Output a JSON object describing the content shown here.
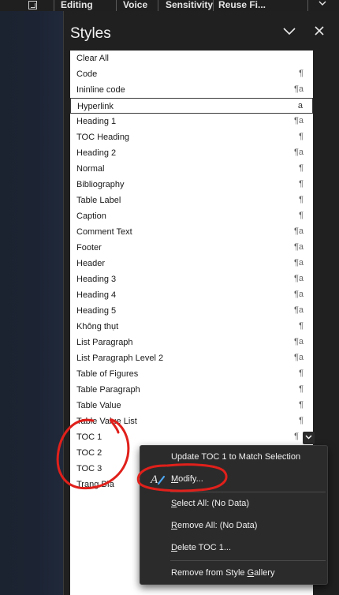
{
  "ribbon": {
    "tabs": [
      "Editing",
      "Voice",
      "Sensitivity",
      "Reuse Fi..."
    ]
  },
  "pane": {
    "title": "Styles"
  },
  "styles": [
    {
      "name": "Clear All",
      "glyph": ""
    },
    {
      "name": "Code",
      "glyph": "¶"
    },
    {
      "name": "Ininline code",
      "glyph": "¶a"
    },
    {
      "name": "Hyperlink",
      "glyph": "a",
      "selected": true
    },
    {
      "name": "Heading 1",
      "glyph": "¶a"
    },
    {
      "name": "TOC Heading",
      "glyph": "¶"
    },
    {
      "name": "Heading 2",
      "glyph": "¶a"
    },
    {
      "name": "Normal",
      "glyph": "¶"
    },
    {
      "name": "Bibliography",
      "glyph": "¶"
    },
    {
      "name": "Table Label",
      "glyph": "¶"
    },
    {
      "name": "Caption",
      "glyph": "¶"
    },
    {
      "name": "Comment Text",
      "glyph": "¶a"
    },
    {
      "name": "Footer",
      "glyph": "¶a"
    },
    {
      "name": "Header",
      "glyph": "¶a"
    },
    {
      "name": "Heading 3",
      "glyph": "¶a"
    },
    {
      "name": "Heading 4",
      "glyph": "¶a"
    },
    {
      "name": "Heading 5",
      "glyph": "¶a"
    },
    {
      "name": "Không thụt",
      "glyph": "¶"
    },
    {
      "name": "List Paragraph",
      "glyph": "¶a"
    },
    {
      "name": "List Paragraph Level 2",
      "glyph": "¶a"
    },
    {
      "name": "Table of Figures",
      "glyph": "¶"
    },
    {
      "name": "Table Paragraph",
      "glyph": "¶"
    },
    {
      "name": "Table Value",
      "glyph": "¶"
    },
    {
      "name": "Table Value List",
      "glyph": "¶"
    },
    {
      "name": "TOC 1",
      "glyph": "¶",
      "dropdown": true
    },
    {
      "name": "TOC 2",
      "glyph": ""
    },
    {
      "name": "TOC 3",
      "glyph": ""
    },
    {
      "name": "Trang Bìa",
      "glyph": ""
    }
  ],
  "context_menu": {
    "items": [
      {
        "label": "Update TOC 1 to Match Selection",
        "accel": ""
      },
      {
        "label_pre": "",
        "accel": "M",
        "label_post": "odify...",
        "icon": "modify-style-icon"
      },
      {
        "label_pre": "",
        "accel": "S",
        "label_post": "elect All: (No Data)"
      },
      {
        "label_pre": "",
        "accel": "R",
        "label_post": "emove All: (No Data)"
      },
      {
        "label_pre": "",
        "accel": "D",
        "label_post": "elete TOC 1..."
      },
      {
        "label_pre": "Remove from Style ",
        "accel": "G",
        "label_post": "allery"
      }
    ]
  },
  "colors": {
    "annotation": "#e0201b",
    "pane_bg": "#202020",
    "list_bg": "#ffffff"
  }
}
